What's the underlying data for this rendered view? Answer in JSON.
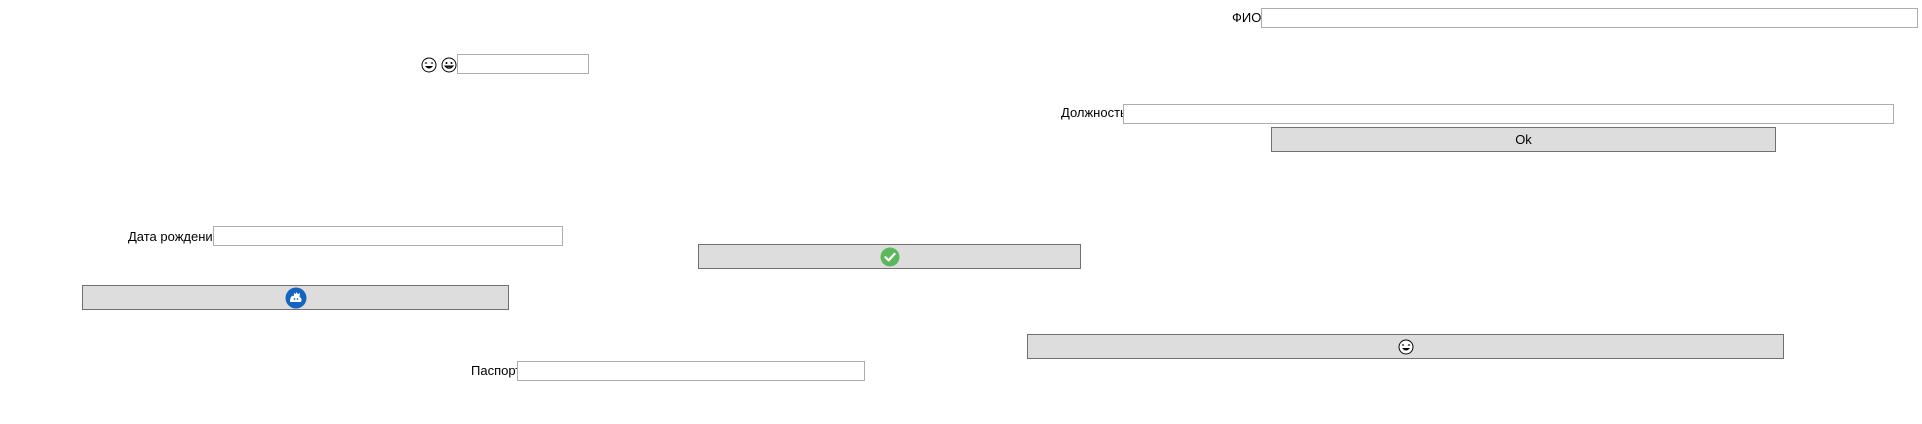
{
  "form": {
    "fio_label": "ФИО",
    "fio_value": "",
    "small_value": "",
    "position_label": "Должность",
    "position_value": "",
    "ok_label": "Ok",
    "birthdate_label": "Дата рождения",
    "birthdate_value": "",
    "passport_label": "Паспорт",
    "passport_value": ""
  },
  "icons": {
    "emoji_1": "laughing-face-icon",
    "emoji_2": "grinning-face-icon",
    "check": "check-circle-icon",
    "badge": "blue-badge-icon",
    "emoji_button": "laughing-face-icon"
  },
  "colors": {
    "button_bg": "#dddddd",
    "button_border": "#707070",
    "input_border": "#abadb3",
    "check_green": "#5cb85c",
    "badge_blue": "#1565c0"
  }
}
